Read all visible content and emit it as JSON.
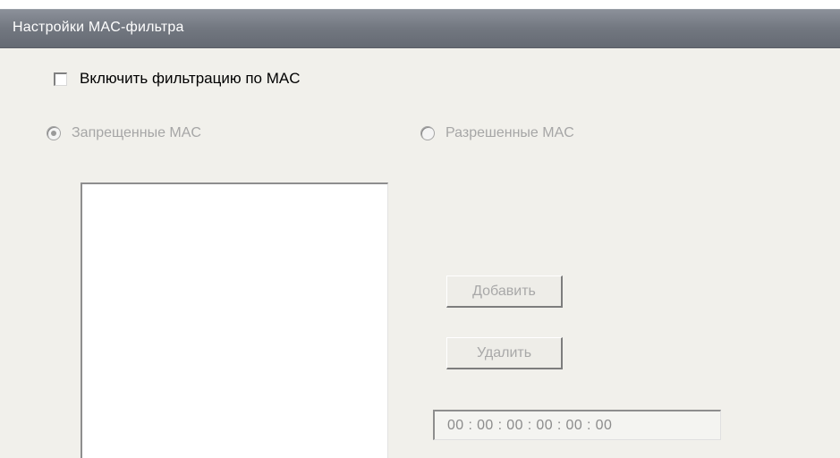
{
  "panel": {
    "title": "Настройки MAC-фильтра"
  },
  "filter": {
    "enable_label": "Включить фильтрацию по MAC",
    "enabled": false
  },
  "mode": {
    "deny_label": "Запрещенные MAC",
    "allow_label": "Разрешенные MAC",
    "selected": "deny"
  },
  "mac_list": {
    "items": []
  },
  "buttons": {
    "add_label": "Добавить",
    "delete_label": "Удалить"
  },
  "mac_input": {
    "value": "00 : 00 : 00 : 00 : 00 : 00"
  },
  "colors": {
    "titlebar": "#727780",
    "background": "#f1f0eb",
    "disabled_text": "#a6a6a6"
  }
}
